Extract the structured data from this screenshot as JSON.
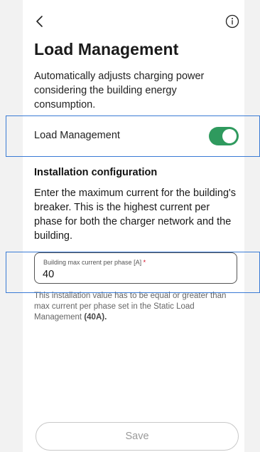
{
  "header": {
    "back_icon": "chevron-left-icon",
    "info_icon": "info-circle-icon"
  },
  "page": {
    "title": "Load Management",
    "description": "Automatically adjusts charging power considering the building energy consumption."
  },
  "load_management": {
    "label": "Load Management",
    "enabled": true,
    "toggle_color": "#2f9a5e"
  },
  "installation": {
    "title": "Installation configuration",
    "description": "Enter the maximum current for the building's breaker. This is the highest current per phase for both the charger network and the building.",
    "field": {
      "label": "Building max current per phase [A]",
      "required_mark": "*",
      "value": "40"
    },
    "helper_text": "This installation value has to be equal or greater than max current per phase set in the Static Load Management",
    "helper_value": "(40A)."
  },
  "actions": {
    "save_label": "Save"
  },
  "colors": {
    "accent": "#2f9a5e",
    "highlight": "#3a7bd5",
    "required": "#d0021b"
  }
}
